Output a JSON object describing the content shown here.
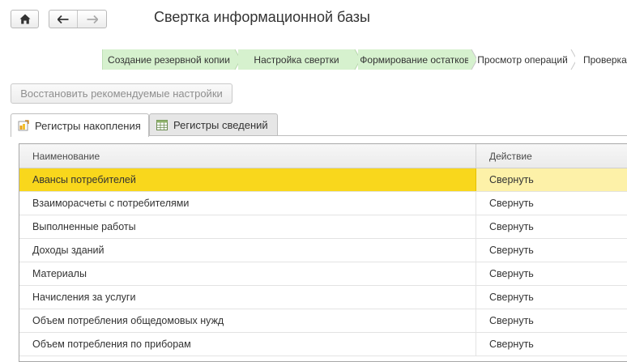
{
  "header": {
    "title": "Свертка информационной базы"
  },
  "steps": [
    {
      "label": "Создание резервной копии",
      "state": "done"
    },
    {
      "label": "Настройка свертки",
      "state": "done"
    },
    {
      "label": "Формирование остатков",
      "state": "done"
    },
    {
      "label": "Просмотр операций",
      "state": "pending"
    },
    {
      "label": "Проверка",
      "state": "pending"
    }
  ],
  "toolbar": {
    "restore_label": "Восстановить рекомендуемые настройки"
  },
  "tabs": [
    {
      "label": "Регистры накопления",
      "active": true,
      "icon": "accumulation-register-icon"
    },
    {
      "label": "Регистры сведений",
      "active": false,
      "icon": "info-register-icon"
    }
  ],
  "table": {
    "columns": [
      "Наименование",
      "Действие"
    ],
    "rows": [
      [
        "Авансы потребителей",
        "Свернуть"
      ],
      [
        "Взаиморасчеты с потребителями",
        "Свернуть"
      ],
      [
        "Выполненные работы",
        "Свернуть"
      ],
      [
        "Доходы зданий",
        "Свернуть"
      ],
      [
        "Материалы",
        "Свернуть"
      ],
      [
        "Начисления за услуги",
        "Свернуть"
      ],
      [
        "Объем потребления общедомовых нужд",
        "Свернуть"
      ],
      [
        "Объем потребления по приборам",
        "Свернуть"
      ]
    ],
    "selected_row": 0
  },
  "colors": {
    "step_done": "#d6f1ce",
    "selection": "#f9d71c",
    "selection_light": "#fdf1a8"
  }
}
